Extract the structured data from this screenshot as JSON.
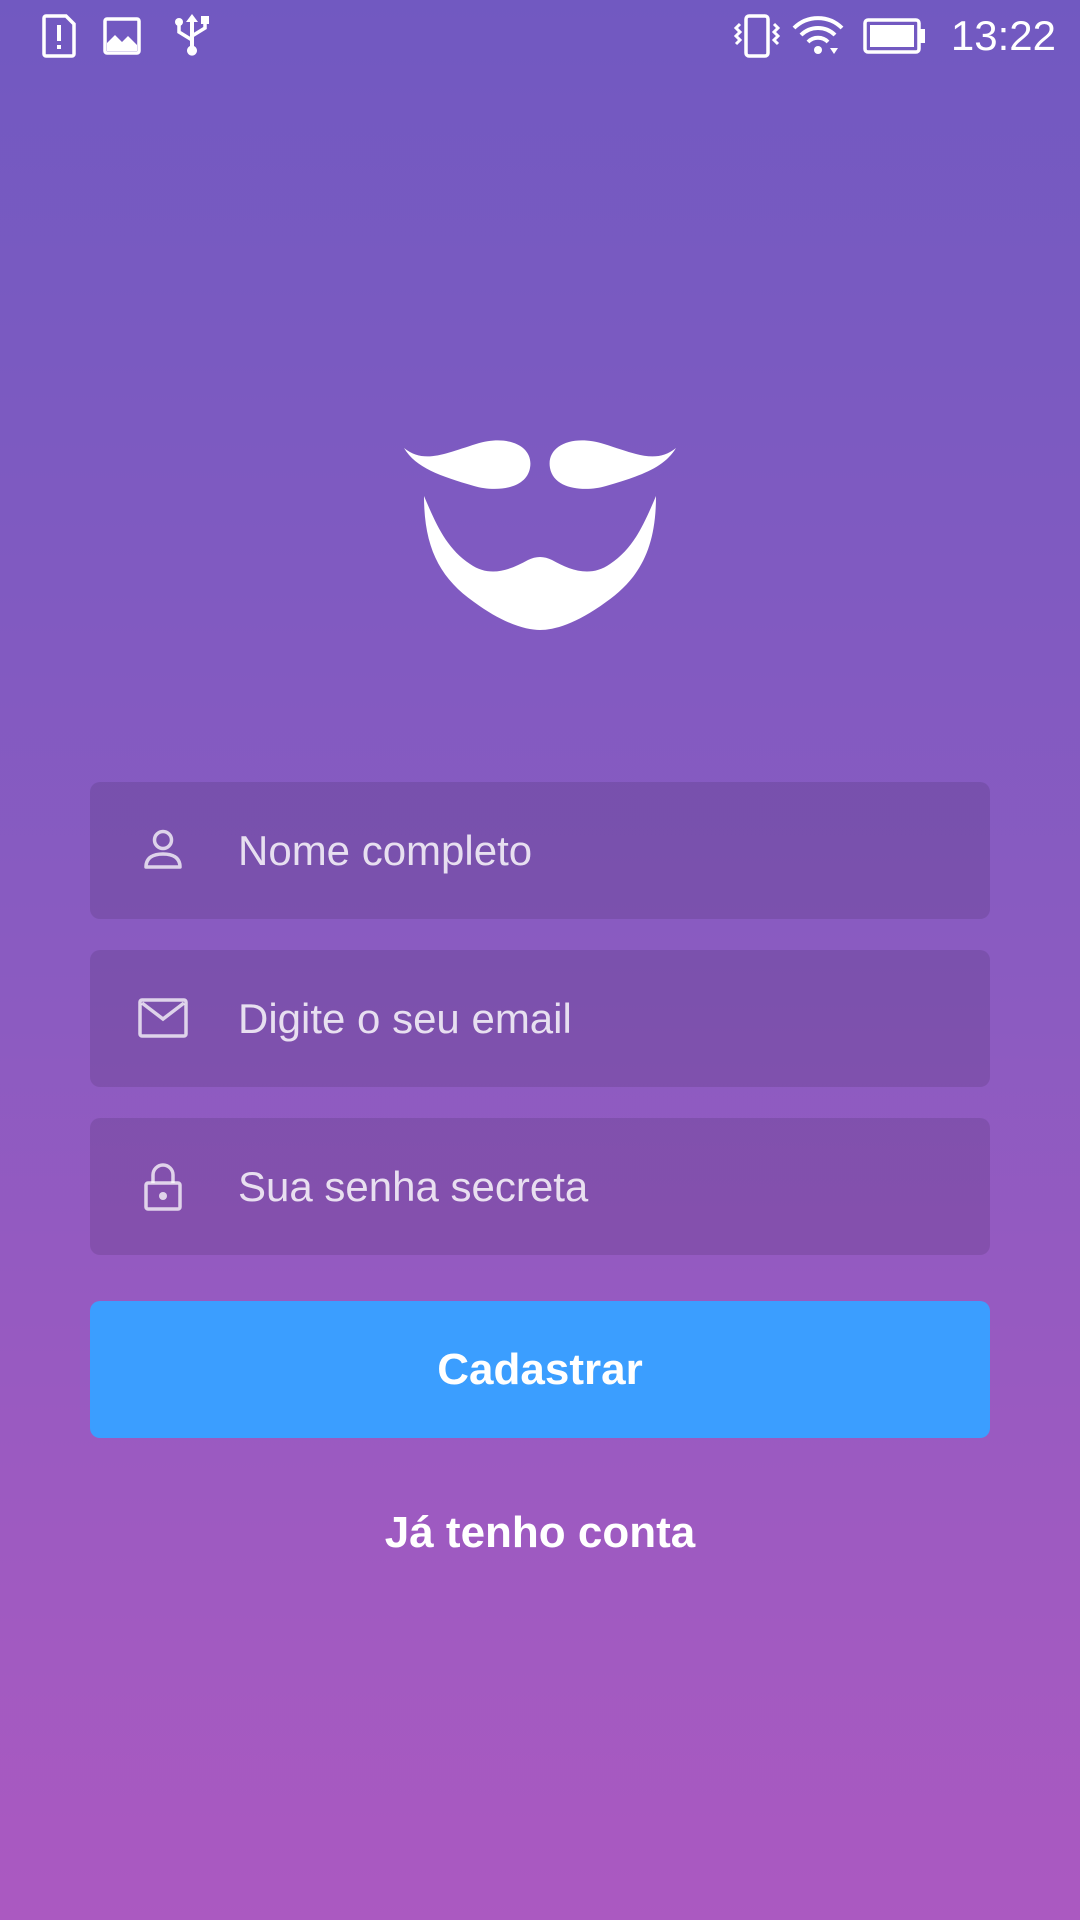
{
  "status_bar": {
    "time": "13:22",
    "left_icons": [
      "sim-alert-icon",
      "image-icon",
      "usb-icon"
    ],
    "right_icons": [
      "vibrate-icon",
      "wifi-icon",
      "battery-icon"
    ]
  },
  "logo": {
    "icon": "mustache-beard-logo"
  },
  "form": {
    "name_placeholder": "Nome completo",
    "name_icon": "person-icon",
    "email_placeholder": "Digite o seu email",
    "email_icon": "mail-icon",
    "password_placeholder": "Sua senha secreta",
    "password_icon": "lock-icon"
  },
  "actions": {
    "submit_label": "Cadastrar",
    "signin_link": "Já tenho conta"
  },
  "colors": {
    "gradient_top": "#7159c1",
    "gradient_bottom": "#ab59c1",
    "button": "#3b9eff",
    "text": "#ffffff"
  }
}
